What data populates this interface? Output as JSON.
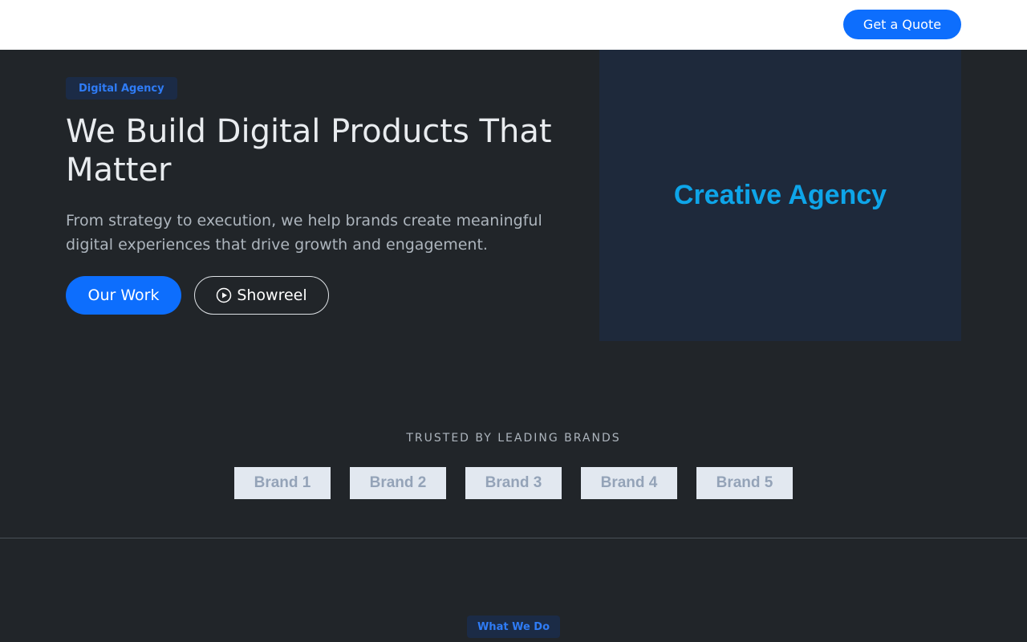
{
  "navbar": {
    "cta_label": "Get a Quote"
  },
  "hero": {
    "badge": "Digital Agency",
    "title": "We Build Digital Products That Matter",
    "subtitle": "From strategy to execution, we help brands create meaningful digital experiences that drive growth and engagement.",
    "primary_button": "Our Work",
    "secondary_button": "Showreel",
    "secondary_icon": "play-circle-icon",
    "image_text": "Creative Agency"
  },
  "trusted": {
    "title": "TRUSTED BY LEADING BRANDS",
    "brands": [
      "Brand 1",
      "Brand 2",
      "Brand 3",
      "Brand 4",
      "Brand 5"
    ]
  },
  "services": {
    "badge": "What We Do"
  },
  "colors": {
    "accent": "#0d6efd",
    "background": "#212529",
    "hero_image_bg": "#1e293b",
    "hero_image_text": "#0ea5e9"
  }
}
